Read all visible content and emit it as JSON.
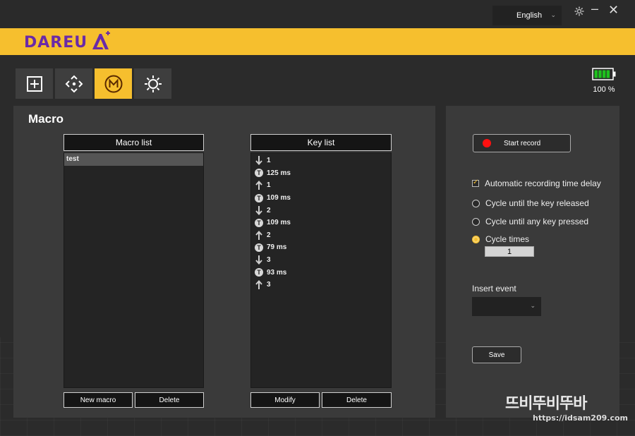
{
  "titlebar": {
    "language": "English"
  },
  "brand": {
    "logo_text": "DAREU",
    "logo_accent": "A",
    "accent_color": "#f6bf2e",
    "logo_color": "#6a2aa8"
  },
  "tabs": [
    {
      "name": "add",
      "icon": "plus-box-icon",
      "active": false
    },
    {
      "name": "move",
      "icon": "directional-arrows-icon",
      "active": false
    },
    {
      "name": "macro",
      "icon": "m-circle-icon",
      "active": true
    },
    {
      "name": "light",
      "icon": "sun-icon",
      "active": false
    }
  ],
  "battery": {
    "percent_label": "100 %",
    "level": 1.0
  },
  "macro": {
    "title": "Macro",
    "macro_list": {
      "header": "Macro list",
      "items": [
        "test"
      ],
      "new_label": "New macro",
      "delete_label": "Delete"
    },
    "key_list": {
      "header": "Key list",
      "items": [
        {
          "kind": "down",
          "label": "1"
        },
        {
          "kind": "time",
          "label": "125 ms"
        },
        {
          "kind": "up",
          "label": "1"
        },
        {
          "kind": "time",
          "label": "109 ms"
        },
        {
          "kind": "down",
          "label": "2"
        },
        {
          "kind": "time",
          "label": "109 ms"
        },
        {
          "kind": "up",
          "label": "2"
        },
        {
          "kind": "time",
          "label": "79 ms"
        },
        {
          "kind": "down",
          "label": "3"
        },
        {
          "kind": "time",
          "label": "93 ms"
        },
        {
          "kind": "up",
          "label": "3"
        }
      ],
      "modify_label": "Modify",
      "delete_label": "Delete"
    }
  },
  "record": {
    "start_label": "Start record",
    "auto_delay_label": "Automatic recording time delay",
    "cycle_release_label": "Cycle until the key released",
    "cycle_any_label": "Cycle until any key pressed",
    "cycle_times_label": "Cycle times",
    "cycle_times_value": "1",
    "selected_option": "cycle_times",
    "insert_event_label": "Insert event",
    "insert_event_value": "",
    "save_label": "Save"
  },
  "watermark": {
    "main": "뜨비뚜비뚜바",
    "url": "https://idsam209.com"
  }
}
